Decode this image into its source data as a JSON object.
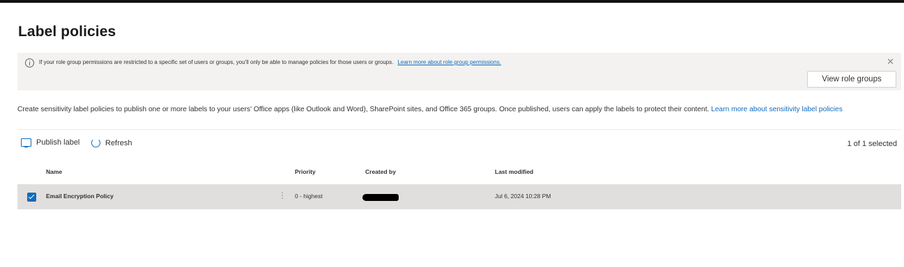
{
  "page": {
    "title": "Label policies"
  },
  "banner": {
    "message": "If your role group permissions are restricted to a specific set of users or groups, you'll only be able to manage policies for those users or groups.",
    "link": "Learn more about role group permissions.",
    "button": "View role groups",
    "close_icon": "close-icon",
    "info_icon": "info-icon"
  },
  "description": {
    "text": "Create sensitivity label policies to publish one or more labels to your users' Office apps (like Outlook and Word), SharePoint sites, and Office 365 groups. Once published, users can apply the labels to protect their content.",
    "link": "Learn more about sensitivity label policies"
  },
  "commands": {
    "publish_label": "Publish label",
    "refresh": "Refresh",
    "selection_count": "1 of 1 selected"
  },
  "table": {
    "columns": [
      "Name",
      "Priority",
      "Created by",
      "Last modified"
    ],
    "rows": [
      {
        "name": "Email Encryption Policy",
        "priority": "0 - highest",
        "created_by": "",
        "last_modified": "Jul 6, 2024 10:28 PM",
        "selected": true
      }
    ]
  },
  "colors": {
    "accent": "#0f6cbd",
    "banner_bg": "#f3f2f1",
    "selected_row_bg": "#e1dfdd"
  }
}
